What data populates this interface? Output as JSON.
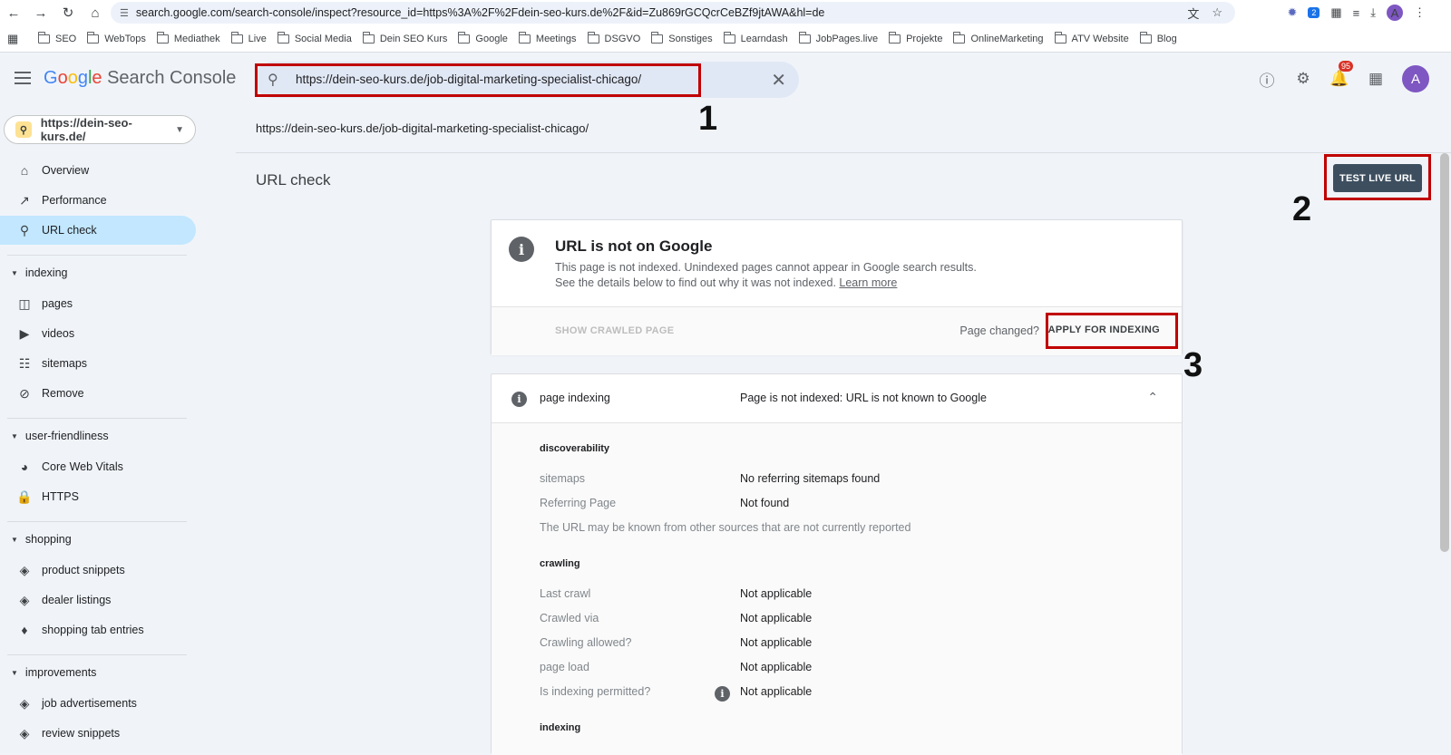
{
  "browser": {
    "url": "search.google.com/search-console/inspect?resource_id=https%3A%2F%2Fdein-seo-kurs.de%2F&id=Zu869rGCQcrCeBZf9jtAWA&hl=de",
    "profile_initial": "A",
    "extension_badge": "2",
    "bookmarks": [
      "SEO",
      "WebTops",
      "Mediathek",
      "Live",
      "Social Media",
      "Dein SEO Kurs",
      "Google",
      "Meetings",
      "DSGVO",
      "Sonstiges",
      "Learndash",
      "JobPages.live",
      "Projekte",
      "OnlineMarketing",
      "ATV Website",
      "Blog"
    ]
  },
  "header": {
    "brand_google": "Google",
    "brand_product": "Search Console",
    "search_value": "https://dein-seo-kurs.de/job-digital-marketing-specialist-chicago/",
    "notification_count": "95",
    "avatar_initial": "A"
  },
  "sidebar": {
    "property": "https://dein-seo-kurs.de/",
    "top_items": [
      {
        "label": "Overview",
        "icon": "home-icon"
      },
      {
        "label": "Performance",
        "icon": "trending-icon"
      },
      {
        "label": "URL check",
        "icon": "search-icon"
      }
    ],
    "sections": [
      {
        "title": "indexing",
        "items": [
          "pages",
          "videos",
          "sitemaps",
          "Remove"
        ]
      },
      {
        "title": "user-friendliness",
        "items": [
          "Core Web Vitals",
          "HTTPS"
        ]
      },
      {
        "title": "shopping",
        "items": [
          "product snippets",
          "dealer listings",
          "shopping tab entries"
        ]
      },
      {
        "title": "improvements",
        "items": [
          "job advertisements",
          "review snippets"
        ]
      }
    ]
  },
  "main": {
    "inspected_url": "https://dein-seo-kurs.de/job-digital-marketing-specialist-chicago/",
    "page_title": "URL check",
    "test_live_label": "TEST LIVE URL",
    "status_card": {
      "title": "URL is not on Google",
      "line1": "This page is not indexed. Unindexed pages cannot appear in Google search results.",
      "line2": "See the details below to find out why it was not indexed.",
      "learn_more": "Learn more",
      "show_crawled": "SHOW CRAWLED PAGE",
      "page_changed": "Page changed?",
      "apply": "APPLY FOR INDEXING"
    },
    "indexing_card": {
      "label": "page indexing",
      "value": "Page is not indexed: URL is not known to Google",
      "discoverability": "discoverability",
      "sitemaps_label": "sitemaps",
      "sitemaps_value": "No referring sitemaps found",
      "referring_label": "Referring Page",
      "referring_value": "Not found",
      "note": "The URL may be known from other sources that are not currently reported",
      "crawling": "crawling",
      "last_crawl_label": "Last crawl",
      "last_crawl_value": "Not applicable",
      "crawled_via_label": "Crawled via",
      "crawled_via_value": "Not applicable",
      "crawl_allowed_label": "Crawling allowed?",
      "crawl_allowed_value": "Not applicable",
      "page_load_label": "page load",
      "page_load_value": "Not applicable",
      "index_permitted_label": "Is indexing permitted?",
      "index_permitted_value": "Not applicable",
      "indexing": "indexing"
    }
  },
  "annotations": {
    "step1": "1",
    "step2": "2",
    "step3": "3"
  },
  "colors": {
    "active_nav": "#c2e7ff",
    "highlight": "#c00000",
    "primary_button": "#3d4f5f"
  }
}
